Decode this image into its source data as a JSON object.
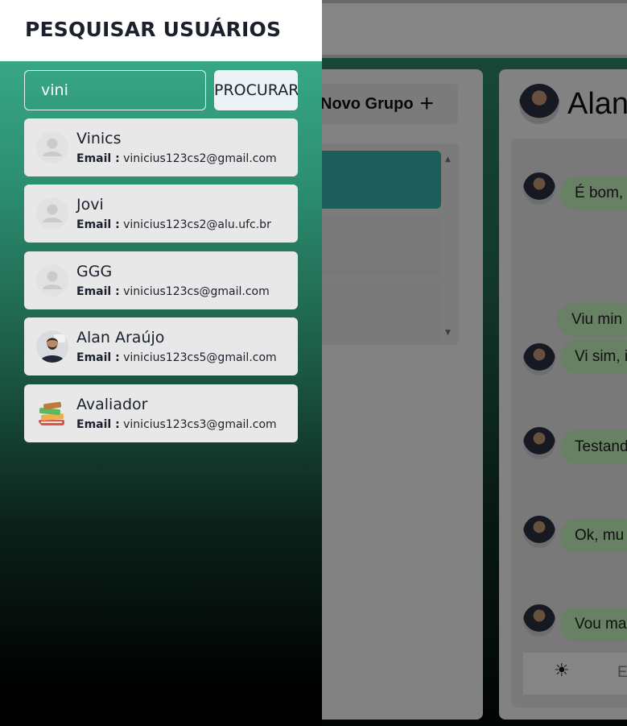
{
  "drawer": {
    "title": "PESQUISAR USUÁRIOS",
    "search_value": "vini",
    "search_button": "PROCURAR",
    "email_label": "Email :",
    "results": [
      {
        "name": "Vinics",
        "email": "vinicius123cs2@gmail.com",
        "avatar": "default-user-icon"
      },
      {
        "name": "Jovi",
        "email": "vinicius123cs2@alu.ufc.br",
        "avatar": "default-user-icon"
      },
      {
        "name": "GGG",
        "email": "vinicius123cs@gmail.com",
        "avatar": "default-user-icon"
      },
      {
        "name": "Alan Araújo",
        "email": "vinicius123cs5@gmail.com",
        "avatar": "profile-photo"
      },
      {
        "name": "Avaliador",
        "email": "vinicius123cs3@gmail.com",
        "avatar": "books-icon"
      }
    ]
  },
  "background": {
    "new_group_label": "Novo Grupo",
    "new_group_icon": "+",
    "conversation_name": "Alan",
    "messages": [
      "É bom,",
      "Viu min",
      "Vi sim, i",
      "Testand",
      "Ok, mu",
      "Vou ma"
    ],
    "input_placeholder": "E",
    "emoji_icon": "☀"
  },
  "colors": {
    "drawer_top": "#3db391",
    "drawer_bottom": "#000000",
    "card_bg": "#e8e8e8",
    "bubble_bg": "#c8f5c0"
  }
}
